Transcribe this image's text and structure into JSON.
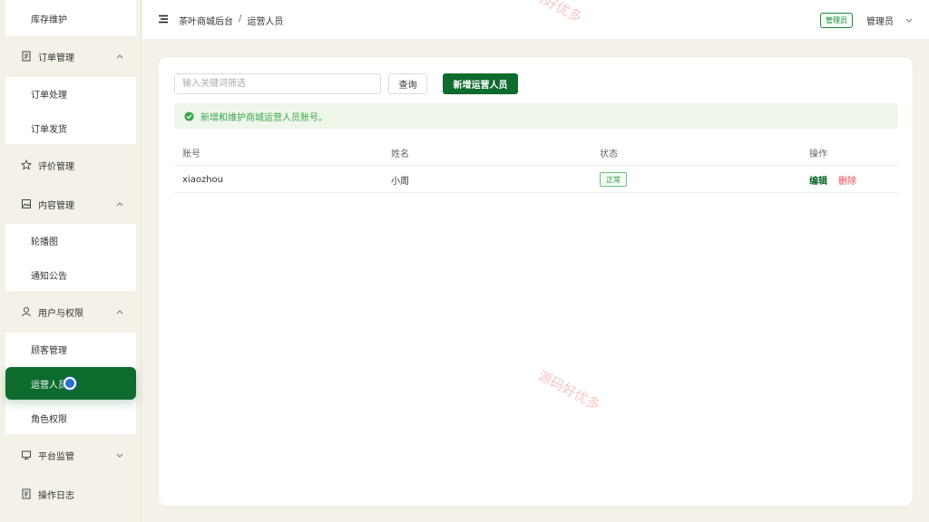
{
  "sidebar": {
    "top_item": "库存维护",
    "order_group": "订单管理",
    "order_items": [
      "订单处理",
      "订单发货"
    ],
    "review": "评价管理",
    "content_group": "内容管理",
    "content_items": [
      "轮播图",
      "通知公告"
    ],
    "users_group": "用户与权限",
    "users_items": [
      "顾客管理",
      "运营人员",
      "角色权限"
    ],
    "monitor_group": "平台监管",
    "log": "操作日志"
  },
  "header": {
    "crumb1": "茶叶商城后台",
    "separator": "/",
    "crumb2": "运营人员",
    "role_badge": "管理员",
    "user_name": "管理员"
  },
  "toolbar": {
    "search_placeholder": "输入关键词筛选",
    "query_label": "查询",
    "add_label": "新增运营人员"
  },
  "alert_text": "新增和维护商城运营人员账号。",
  "table": {
    "columns": [
      "账号",
      "姓名",
      "状态",
      "操作"
    ],
    "rows": [
      {
        "account": "xiaozhou",
        "name": "小周",
        "status": "正常",
        "edit": "编辑",
        "delete": "删除"
      }
    ]
  },
  "watermark": "源码好优多",
  "colors": {
    "primary": "#0d6b2e",
    "danger": "#e0474f",
    "success": "#3aa64a",
    "background": "#f4f1e8"
  }
}
